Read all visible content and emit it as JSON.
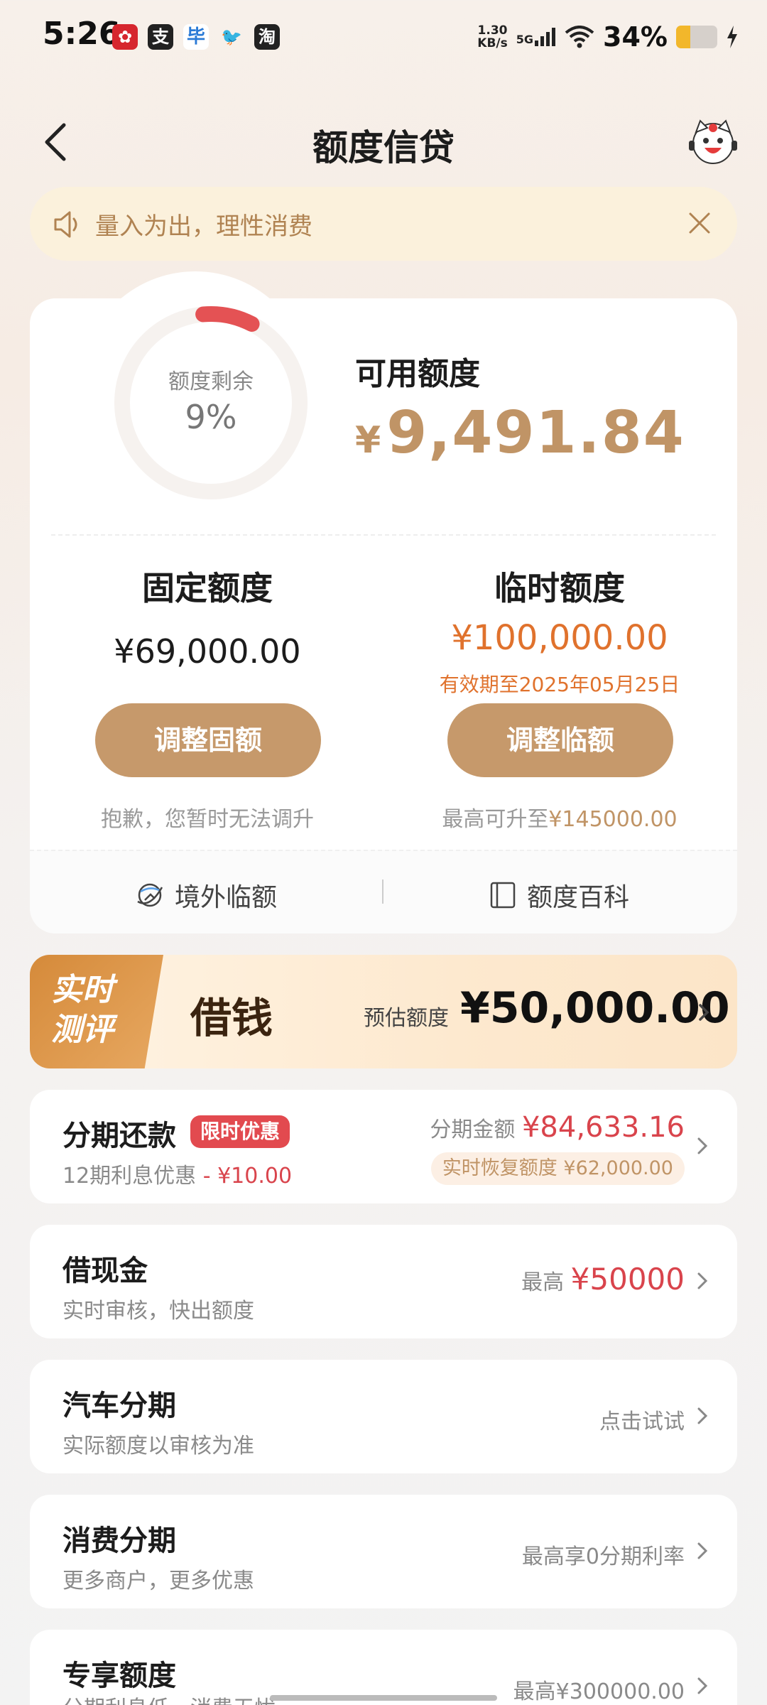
{
  "status_bar": {
    "time": "5:26",
    "app_icons": [
      {
        "name": "app-icon-red",
        "glyph": "✿",
        "color": "#d6262e"
      },
      {
        "name": "alipay-icon",
        "glyph": "支",
        "color": "#222222"
      },
      {
        "name": "app-icon-blue",
        "glyph": "毕",
        "color": "#2a7ad6"
      },
      {
        "name": "bird-icon",
        "glyph": "🐦",
        "color": "#333333"
      },
      {
        "name": "taobao-icon",
        "glyph": "淘",
        "color": "#222222"
      }
    ],
    "net_speed_value": "1.30",
    "net_speed_unit": "KB/s",
    "network": "5G",
    "battery": "34%",
    "battery_level": 0.34
  },
  "header": {
    "title": "额度信贷"
  },
  "notice": {
    "text": "量入为出，理性消费"
  },
  "quota": {
    "ring_label": "额度剩余",
    "ring_percent": "9%",
    "ring_value": 0.09,
    "available_label": "可用额度",
    "available_currency": "¥",
    "available_amount": "9,491.84",
    "fixed": {
      "title": "固定额度",
      "amount": "¥69,000.00",
      "button": "调整固额",
      "note": "抱歉，您暂时无法调升"
    },
    "temporary": {
      "title": "临时额度",
      "amount": "¥100,000.00",
      "valid": "有效期至2025年05月25日",
      "button": "调整临额",
      "note_prefix": "最高可升至",
      "note_amount": "¥145000.00"
    },
    "footer": {
      "overseas": "境外临额",
      "encyclopedia": "额度百科"
    }
  },
  "borrow_banner": {
    "tag_line1": "实时",
    "tag_line2": "测评",
    "title": "借钱",
    "estimate_label": "预估额度",
    "estimate_amount": "¥50,000.00"
  },
  "list": [
    {
      "title": "分期还款",
      "badge": "限时优惠",
      "sub_prefix": "12期利息优惠",
      "sub_discount": "- ¥10.00",
      "right_label": "分期金额",
      "right_amount": "¥84,633.16",
      "recover": "实时恢复额度 ¥62,000.00"
    },
    {
      "title": "借现金",
      "sub": "实时审核，快出额度",
      "right_label": "最高",
      "right_amount": "¥50000"
    },
    {
      "title": "汽车分期",
      "sub": "实际额度以审核为准",
      "right_label": "点击试试"
    },
    {
      "title": "消费分期",
      "sub": "更多商户，更多优惠",
      "right_label": "最高享0分期利率"
    },
    {
      "title": "专享额度",
      "sub": "分期利息低，消费无忧",
      "right_label": "最高¥300000.00"
    }
  ]
}
